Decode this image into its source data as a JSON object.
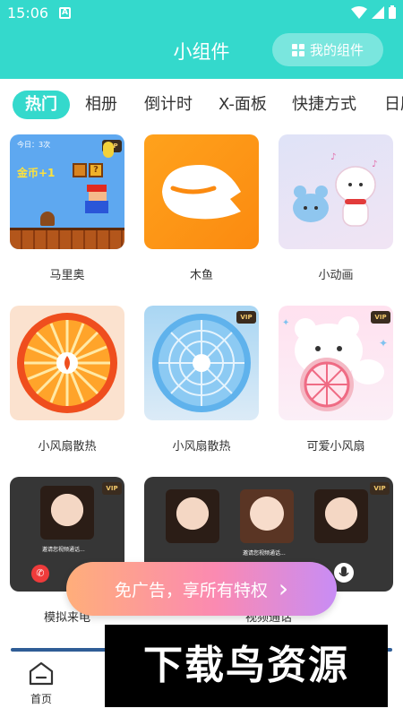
{
  "status_bar": {
    "time": "15:06",
    "notice_letter": "A"
  },
  "header": {
    "title": "小组件",
    "my_widgets_label": "我的组件"
  },
  "tabs": [
    {
      "label": "热门",
      "active": true
    },
    {
      "label": "相册"
    },
    {
      "label": "倒计时"
    },
    {
      "label": "X-面板"
    },
    {
      "label": "快捷方式"
    },
    {
      "label": "日历"
    }
  ],
  "widgets": {
    "mario": {
      "label": "马里奥",
      "today": "今日：3次",
      "coins": "金币+1",
      "vip": "VIP"
    },
    "woodfish": {
      "label": "木鱼"
    },
    "animation": {
      "label": "小动画"
    },
    "fan_orange": {
      "label": "小风扇散热"
    },
    "fan_blue": {
      "label": "小风扇散热",
      "vip": "VIP"
    },
    "fan_cute": {
      "label": "可爱小风扇",
      "vip": "VIP"
    },
    "call_sim": {
      "label": "模拟来电",
      "invite": "邀请您视频通话...",
      "vip": "VIP"
    },
    "video_call": {
      "label": "视频通话",
      "invite": "邀请您视频通话...",
      "vip": "VIP"
    }
  },
  "promo": {
    "text": "免广告，享所有特权",
    "arrow": "›"
  },
  "bottom_nav": {
    "home_label": "首页"
  },
  "watermark": {
    "text": "下载鸟资源"
  },
  "colors": {
    "accent": "#34d9cc",
    "promo_start": "#ffae7a",
    "promo_end": "#c88cf5"
  }
}
